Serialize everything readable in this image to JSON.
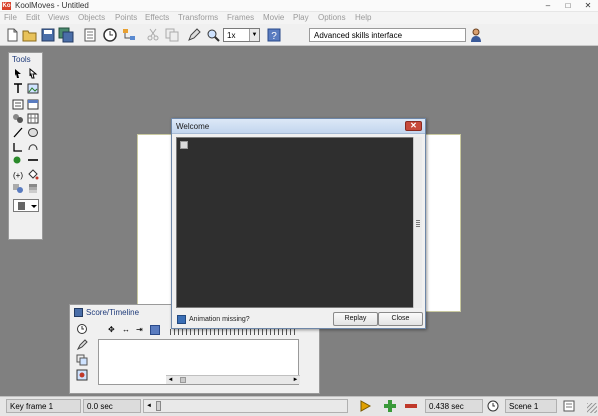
{
  "window": {
    "title": "KoolMoves - Untitled",
    "controls": {
      "minimize": "–",
      "maximize": "□",
      "close": "✕"
    }
  },
  "menu": [
    "File",
    "Edit",
    "Views",
    "Objects",
    "Points",
    "Effects",
    "Transforms",
    "Frames",
    "Movie",
    "Play",
    "Options",
    "Help"
  ],
  "toolbar": {
    "zoom_value": "1x",
    "interface_mode": "Advanced skills interface",
    "icons": [
      "new-file-icon",
      "open-folder-icon",
      "save-icon",
      "save-all-icon",
      "page-icon",
      "clock-icon",
      "hierarchy-icon",
      "cut-icon",
      "copy-icon",
      "pen-icon",
      "zoom-icon",
      "help-icon",
      "user-icon"
    ]
  },
  "tools_palette": {
    "title": "Tools"
  },
  "timeline": {
    "title": "Score/Timeline"
  },
  "dialog": {
    "title": "Welcome",
    "close_label": "✕",
    "help_text": "Animation missing?",
    "replay_label": "Replay",
    "close_button_label": "Close"
  },
  "status": {
    "frame": "Key frame 1",
    "time": "0.0 sec",
    "duration": "0.438 sec",
    "scene": "Scene 1"
  },
  "colors": {
    "workspace": "#808080",
    "stage": "#ffffff",
    "dialog_video": "#2f2f2f",
    "dialog_close": "#c74a3b",
    "play_button": "#e0a000",
    "add_button": "#3a9a3a",
    "remove_button": "#c0392b"
  }
}
